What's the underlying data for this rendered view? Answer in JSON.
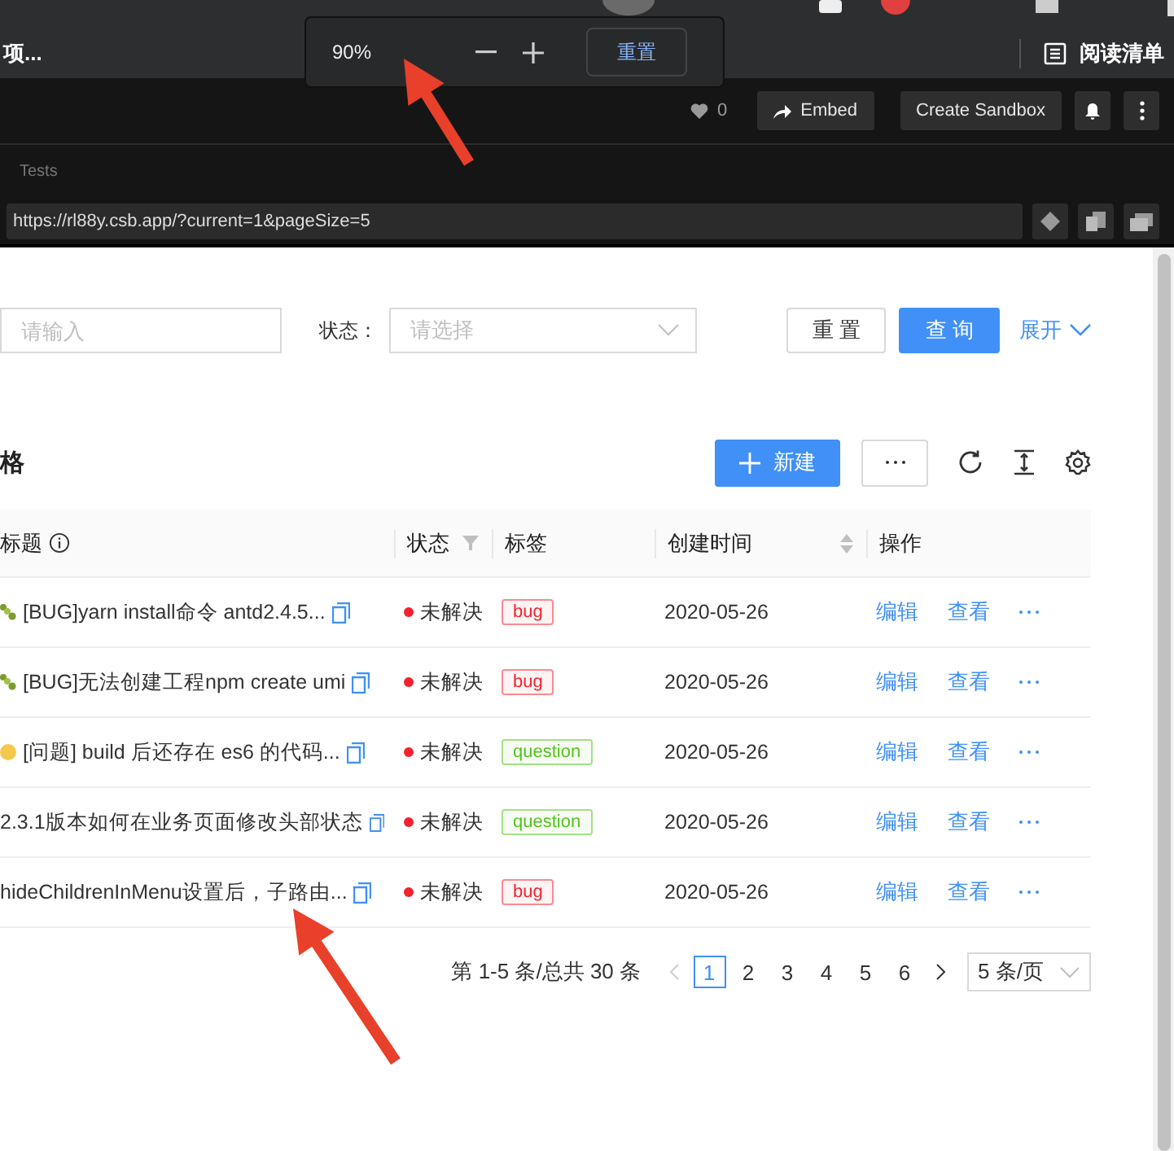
{
  "browser": {
    "tab_title": "项...",
    "reading_list": "阅读清单"
  },
  "zoom_popup": {
    "level": "90%",
    "reset": "重置"
  },
  "sandbox_toolbar": {
    "likes": "0",
    "embed": "Embed",
    "create": "Create Sandbox"
  },
  "preview": {
    "panel_label": "Tests",
    "url": "https://rl88y.csb.app/?current=1&pageSize=5"
  },
  "search_form": {
    "title_field": {
      "placeholder": "请输入"
    },
    "status_field": {
      "label": "状态：",
      "placeholder": "请选择"
    },
    "reset": "重 置",
    "submit": "查 询",
    "expand": "展开"
  },
  "table_toolbar": {
    "title": "格",
    "new_button": "新建"
  },
  "table": {
    "columns": [
      {
        "label": "标题",
        "kind": "info"
      },
      {
        "label": "状态",
        "kind": "filter"
      },
      {
        "label": "标签",
        "kind": "plain"
      },
      {
        "label": "创建时间",
        "kind": "sort"
      },
      {
        "label": "操作",
        "kind": "plain"
      }
    ],
    "rows": [
      {
        "kind": "bug",
        "title": "[BUG]yarn install命令 antd2.4.5...",
        "status": "未解决",
        "tag": {
          "label": "bug",
          "color": "#f5222d"
        },
        "created": "2020-05-26",
        "actions": [
          "编辑",
          "查看"
        ]
      },
      {
        "kind": "bug",
        "title": "[BUG]无法创建工程npm create umi",
        "status": "未解决",
        "tag": {
          "label": "bug",
          "color": "#f5222d"
        },
        "created": "2020-05-26",
        "actions": [
          "编辑",
          "查看"
        ]
      },
      {
        "kind": "question",
        "title": "[问题] build 后还存在 es6 的代码...",
        "status": "未解决",
        "tag": {
          "label": "question",
          "color": "#52c41a"
        },
        "created": "2020-05-26",
        "actions": [
          "编辑",
          "查看"
        ]
      },
      {
        "kind": "plain",
        "title": "2.3.1版本如何在业务页面修改头部状态",
        "status": "未解决",
        "tag": {
          "label": "question",
          "color": "#52c41a"
        },
        "created": "2020-05-26",
        "actions": [
          "编辑",
          "查看"
        ]
      },
      {
        "kind": "plain",
        "title": "hideChildrenInMenu设置后，子路由...",
        "status": "未解决",
        "tag": {
          "label": "bug",
          "color": "#f5222d"
        },
        "created": "2020-05-26",
        "actions": [
          "编辑",
          "查看"
        ]
      }
    ]
  },
  "pagination": {
    "summary": "第 1-5 条/总共 30 条",
    "pages": [
      {
        "label": "1",
        "selected": true
      },
      {
        "label": "2",
        "selected": false
      },
      {
        "label": "3",
        "selected": false
      },
      {
        "label": "4",
        "selected": false
      },
      {
        "label": "5",
        "selected": false
      },
      {
        "label": "6",
        "selected": false
      }
    ],
    "page_size": "5 条/页"
  }
}
